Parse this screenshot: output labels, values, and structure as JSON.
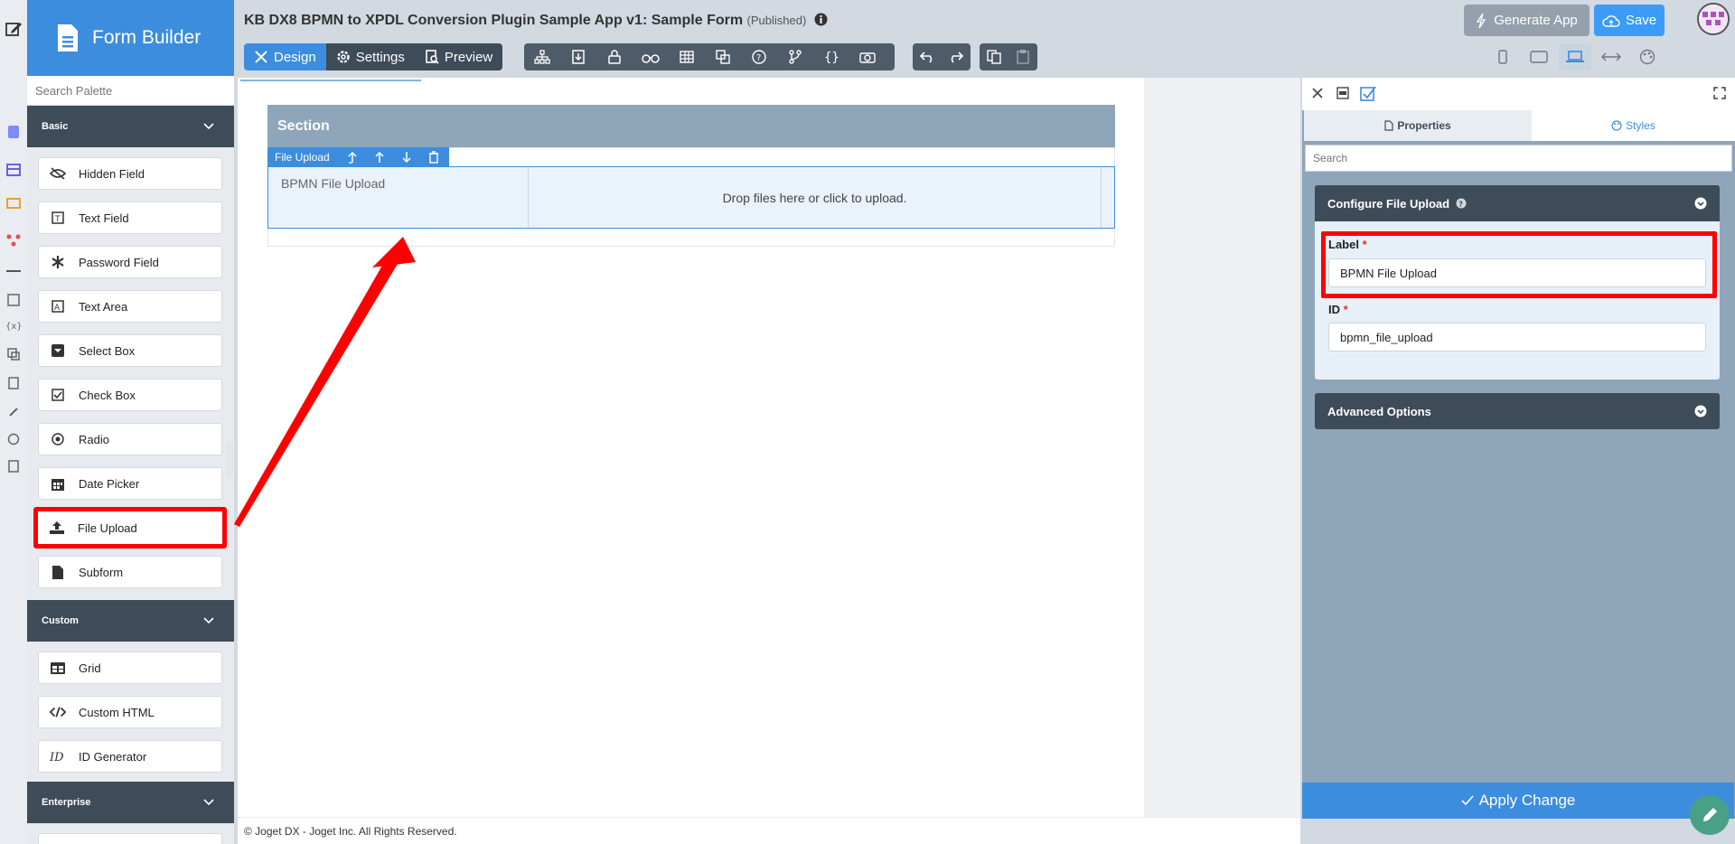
{
  "brand": {
    "title": "Form Builder"
  },
  "header": {
    "title": "KB DX8 BPMN to XPDL Conversion Plugin Sample App v1: Sample Form",
    "status": "(Published)",
    "generate_app": "Generate App",
    "save": "Save"
  },
  "tabs": {
    "design": "Design",
    "settings": "Settings",
    "preview": "Preview"
  },
  "palette": {
    "search_placeholder": "Search Palette",
    "basic": "Basic",
    "custom": "Custom",
    "enterprise": "Enterprise",
    "items": [
      "Hidden Field",
      "Text Field",
      "Password Field",
      "Text Area",
      "Select Box",
      "Check Box",
      "Radio",
      "Date Picker",
      "File Upload",
      "Subform"
    ],
    "custom_items": [
      "Grid",
      "Custom HTML",
      "ID Generator"
    ]
  },
  "canvas": {
    "section_title": "Section",
    "element_toolbar_label": "File Upload",
    "element_label": "BPMN File Upload",
    "dropzone_text": "Drop files here or click to upload."
  },
  "footer": {
    "text": "© Joget DX - Joget Inc. All Rights Reserved."
  },
  "panel": {
    "tab_properties": "Properties",
    "tab_styles": "Styles",
    "search_placeholder": "Search",
    "configure_title": "Configure File Upload",
    "label_field": "Label",
    "label_value": "BPMN File Upload",
    "id_field": "ID",
    "id_value": "bpmn_file_upload",
    "advanced": "Advanced Options",
    "apply": "Apply Change",
    "required_mark": "*"
  },
  "colors": {
    "accent": "#3c8dde",
    "highlight": "#ff0000",
    "dark": "#3e4b58"
  }
}
